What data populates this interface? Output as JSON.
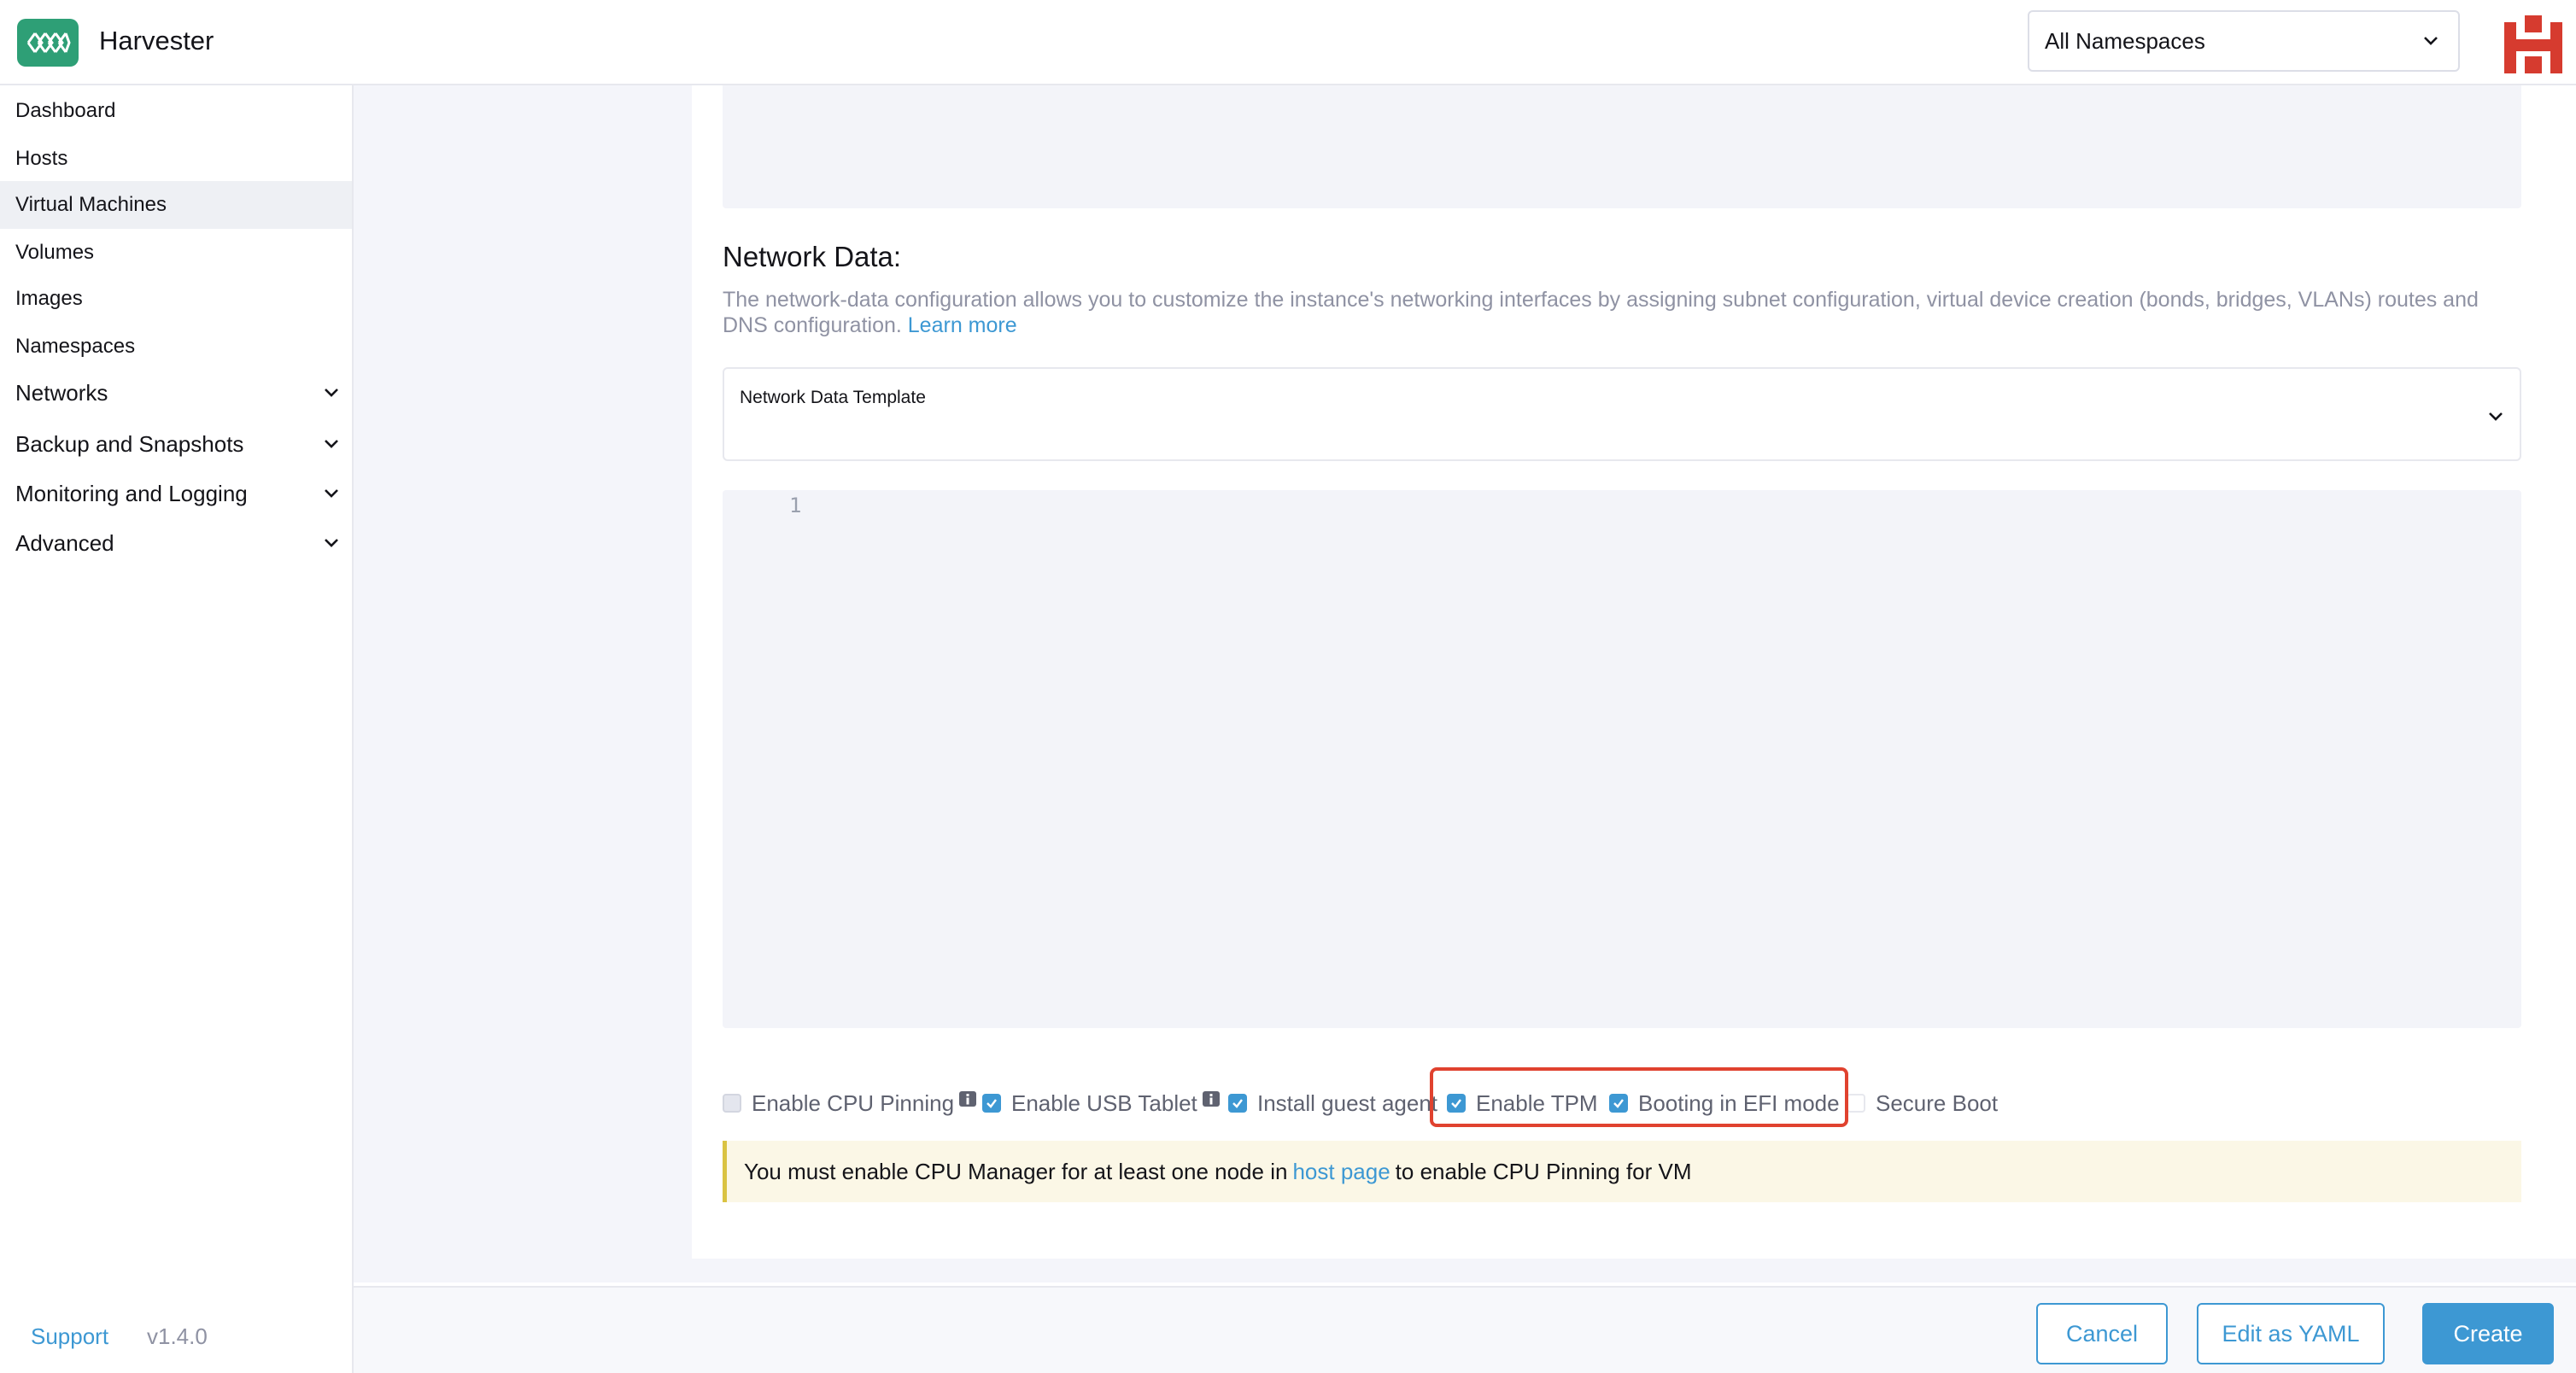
{
  "header": {
    "app_title": "Harvester",
    "namespace_select": "All Namespaces"
  },
  "sidebar": {
    "items": [
      {
        "label": "Dashboard"
      },
      {
        "label": "Hosts"
      },
      {
        "label": "Virtual Machines",
        "active": true
      },
      {
        "label": "Volumes"
      },
      {
        "label": "Images"
      },
      {
        "label": "Namespaces"
      },
      {
        "label": "Networks",
        "expandable": true
      },
      {
        "label": "Backup and Snapshots",
        "expandable": true
      },
      {
        "label": "Monitoring and Logging",
        "expandable": true
      },
      {
        "label": "Advanced",
        "expandable": true
      }
    ],
    "support": "Support",
    "version": "v1.4.0"
  },
  "network_data": {
    "title": "Network Data:",
    "description": "The network-data configuration allows you to customize the instance's networking interfaces by assigning subnet configuration, virtual device creation (bonds, bridges, VLANs) routes and DNS configuration.",
    "learn_more": "Learn more",
    "template_label": "Network Data Template",
    "template_value": "",
    "editor_line_number": "1"
  },
  "options": [
    {
      "label": "Enable CPU Pinning",
      "checked": false,
      "disabled": true,
      "info": true
    },
    {
      "label": "Enable USB Tablet",
      "checked": true,
      "info": true
    },
    {
      "label": "Install guest agent",
      "checked": true
    },
    {
      "label": "Enable TPM",
      "checked": true
    },
    {
      "label": "Booting in EFI mode",
      "checked": true
    },
    {
      "label": "Secure Boot",
      "checked": false
    }
  ],
  "banner": {
    "prefix": "You must enable CPU Manager for at least one node in",
    "link": "host page",
    "suffix": "to enable CPU Pinning for VM"
  },
  "footer": {
    "cancel": "Cancel",
    "edit_yaml": "Edit as YAML",
    "create": "Create"
  },
  "colors": {
    "accent": "#3d98d3",
    "brand": "#2e9f76",
    "highlight": "#e0422f",
    "banner_bg": "#fbf7e6"
  }
}
